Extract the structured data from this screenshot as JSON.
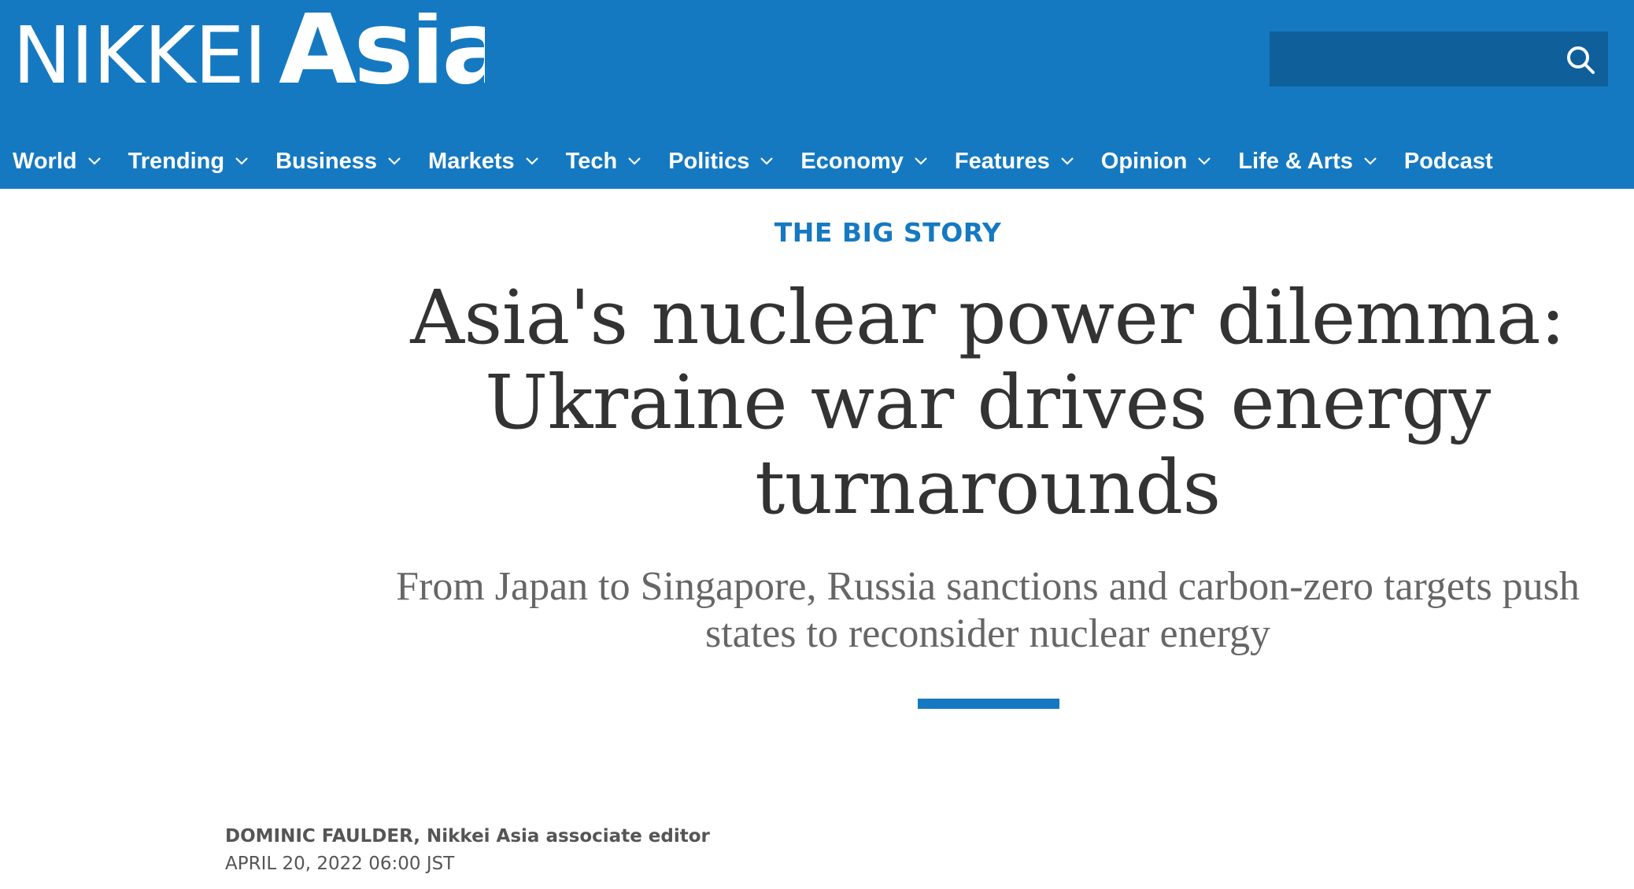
{
  "brand": {
    "logo_part1": "NIKKEI",
    "logo_part2": "Asia",
    "color": "#1579c1"
  },
  "search": {
    "placeholder": "",
    "icon": "search-icon"
  },
  "nav": {
    "items": [
      {
        "label": "World",
        "has_dropdown": true
      },
      {
        "label": "Trending",
        "has_dropdown": true
      },
      {
        "label": "Business",
        "has_dropdown": true
      },
      {
        "label": "Markets",
        "has_dropdown": true
      },
      {
        "label": "Tech",
        "has_dropdown": true
      },
      {
        "label": "Politics",
        "has_dropdown": true
      },
      {
        "label": "Economy",
        "has_dropdown": true
      },
      {
        "label": "Features",
        "has_dropdown": true
      },
      {
        "label": "Opinion",
        "has_dropdown": true
      },
      {
        "label": "Life & Arts",
        "has_dropdown": true
      },
      {
        "label": "Podcast",
        "has_dropdown": false
      }
    ]
  },
  "article": {
    "kicker": "THE BIG STORY",
    "headline": "Asia's nuclear power dilemma: Ukraine war drives energy turnarounds",
    "subheadline": "From Japan to Singapore, Russia sanctions and carbon-zero targets push states to reconsider nuclear energy",
    "author": "DOMINIC FAULDER, Nikkei Asia associate editor",
    "date": "APRIL 20, 2022 06:00 JST"
  }
}
